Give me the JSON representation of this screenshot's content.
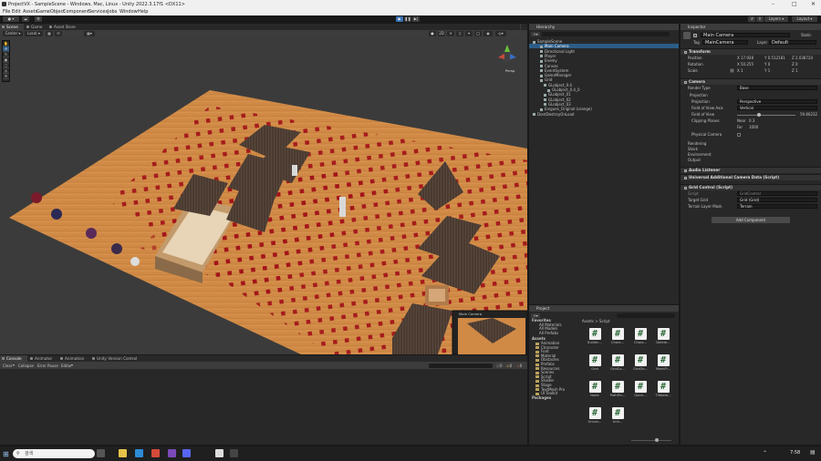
{
  "window": {
    "title": "ProjectVX - SampleScene - Windows, Mac, Linux - Unity 2022.3.17f1 <DX11>"
  },
  "menu": [
    "File",
    "Edit",
    "Assets",
    "GameObject",
    "Component",
    "Services",
    "Jobs",
    "Window",
    "Help"
  ],
  "toolbar": {
    "layers_label": "Layers",
    "layout_label": "Layout"
  },
  "scene_tabs": [
    "Scene",
    "Game",
    "Asset Store"
  ],
  "scene_toolbar": {
    "center": "Center",
    "local": "Local",
    "persp": "Persp"
  },
  "hierarchy": {
    "title": "Hierarchy",
    "rows": [
      {
        "label": "SampleScene",
        "indent": 0,
        "selected": false
      },
      {
        "label": "Main Camera",
        "indent": 2,
        "selected": true
      },
      {
        "label": "Directional Light",
        "indent": 2,
        "selected": false
      },
      {
        "label": "Player",
        "indent": 2,
        "selected": false
      },
      {
        "label": "Enemy",
        "indent": 2,
        "selected": false
      },
      {
        "label": "Canvas",
        "indent": 2,
        "selected": false
      },
      {
        "label": "EventSystem",
        "indent": 2,
        "selected": false
      },
      {
        "label": "GameManager",
        "indent": 2,
        "selected": false
      },
      {
        "label": "Grid",
        "indent": 2,
        "selected": false
      },
      {
        "label": "GLobject_0.4",
        "indent": 3,
        "selected": false
      },
      {
        "label": "GLobject_0.4_0",
        "indent": 4,
        "selected": false
      },
      {
        "label": "GLobject_01",
        "indent": 3,
        "selected": false
      },
      {
        "label": "GLobject_02",
        "indent": 3,
        "selected": false
      },
      {
        "label": "GLobject_03",
        "indent": 3,
        "selected": false
      },
      {
        "label": "Enigues_Original (orange)",
        "indent": 2,
        "selected": false
      },
      {
        "label": "DontDestroyOnLoad",
        "indent": 0,
        "selected": false
      }
    ]
  },
  "inspector": {
    "title": "Inspector",
    "static_label": "Static",
    "object_name": "Main Camera",
    "tag_label": "Tag",
    "tag_value": "MainCamera",
    "layer_label": "Layer",
    "layer_value": "Default",
    "transform": {
      "header": "Transform",
      "position_label": "Position",
      "position": [
        "X 17.928",
        "Y 0.512181",
        "Z 2.038724"
      ],
      "rotation_label": "Rotation",
      "rotation": [
        "X 50.255",
        "Y 0",
        "Z 0"
      ],
      "scale_label": "Scale",
      "scale": [
        "X 1",
        "Y 1",
        "Z 1"
      ]
    },
    "camera": {
      "header": "Camera",
      "render_type_label": "Render Type",
      "render_type": "Base",
      "projection_header": "Projection",
      "projection_label": "Projection",
      "projection": "Perspective",
      "fov_axis_label": "Field of View Axis",
      "fov_axis": "Vertical",
      "fov_label": "Field of View",
      "fov": "59.80232",
      "clipping_label": "Clipping Planes",
      "near_label": "Near",
      "near": "0.3",
      "far_label": "Far",
      "far": "1000",
      "physical_label": "Physical Camera",
      "sections": [
        "Rendering",
        "Stack",
        "Environment",
        "Output"
      ]
    },
    "components": [
      "Audio Listener",
      "Universal Additional Camera Data (Script)",
      "Grid Control (Script)"
    ],
    "grid_control": {
      "script_label": "Script",
      "script": "GridControl",
      "target_label": "Target Grid",
      "target": "Grid (Grid)",
      "mask_label": "Terrain Layer Mask",
      "mask": "Terrain"
    },
    "add_component": "Add Component"
  },
  "project": {
    "title": "Project",
    "breadcrumb": "Assets > Script",
    "favorites_label": "Favorites",
    "favorites": [
      "All Materials",
      "All Models",
      "All Prefabs"
    ],
    "assets_label": "Assets",
    "folders": [
      "Animation",
      "Character",
      "Font",
      "Material",
      "Obstacles",
      "Prefabs",
      "Resources",
      "Scenes",
      "Script",
      "Shader",
      "Stage",
      "TextMesh Pro",
      "UI Toolkit"
    ],
    "packages_label": "Packages",
    "files": [
      "Buildin...",
      "Chara...",
      "Chara...",
      "Delete...",
      "Grid",
      "GridCo...",
      "GridOb...",
      "MeshPl...",
      "Node",
      "PathFin...",
      "Quick...",
      "Tiltdata...",
      "Univer...",
      "Unit..."
    ]
  },
  "console": {
    "tabs": [
      "Console",
      "Animator",
      "Animation",
      "Unity Version Control"
    ],
    "clear": "Clear",
    "collapse": "Collapse",
    "error_pause": "Error Pause",
    "editor": "Editor",
    "counts": [
      "0",
      "0",
      "0"
    ]
  },
  "mini_camera": {
    "label": "Main Camera"
  },
  "taskbar": {
    "search": "검색",
    "time": "7:58"
  },
  "gizmo": {
    "persp": "Persp"
  }
}
